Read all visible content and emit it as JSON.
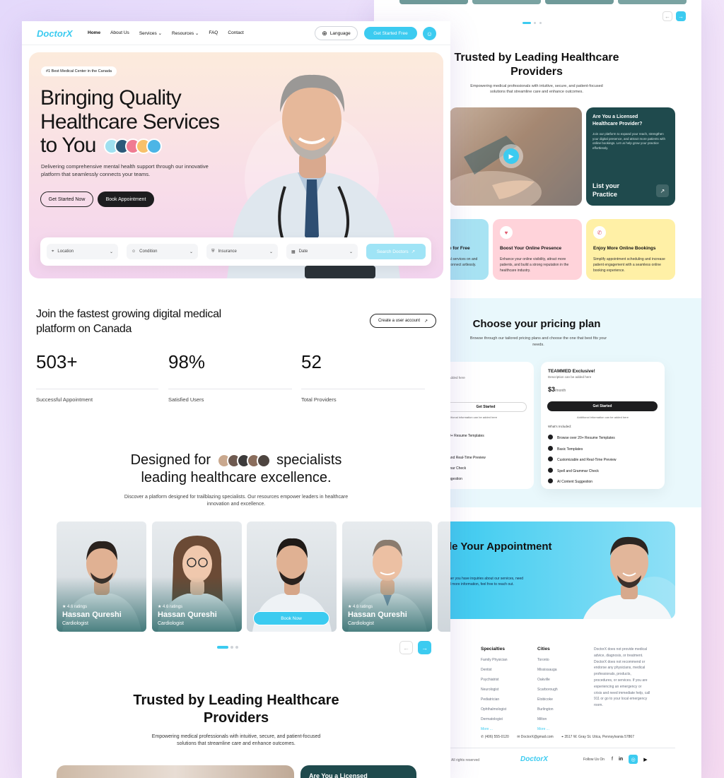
{
  "brand": {
    "logo": "DoctorX",
    "accent": "#3ccbf0",
    "dark": "#1d1d1f",
    "teal": "#1f4a4d"
  },
  "nav": {
    "items": [
      "Home",
      "About Us",
      "Services",
      "Resources",
      "FAQ",
      "Contact"
    ],
    "language": "Language",
    "cta": "Get Started Free"
  },
  "hero": {
    "badge": "#1 Best Medical Center in the Canada",
    "title_line1": "Bringing Quality",
    "title_line2": "Healthcare Services",
    "title_line3": "to You",
    "subtitle": "Delivering comprehensive mental health support through our innovative platform that seamlessly connects your teams.",
    "btn_start": "Get Started Now",
    "btn_book": "Book Appointment"
  },
  "search": {
    "location": "Location",
    "condition": "Condition",
    "insurance": "Insurance",
    "date": "Date",
    "button": "Search Doctors"
  },
  "stats": {
    "heading": "Join the fastest growing digital medical platform on Canada",
    "create_btn": "Create a user account",
    "items": [
      {
        "value": "503+",
        "label": "Successful Appointment"
      },
      {
        "value": "98%",
        "label": "Satisfied Users"
      },
      {
        "value": "52",
        "label": "Total Providers"
      }
    ]
  },
  "designed": {
    "title_pre": "Designed for",
    "title_post": "specialists",
    "title_line2": "leading healthcare excellence.",
    "subtitle": "Discover a platform designed for trailblazing specialists. Our resources empower leaders in healthcare innovation and excellence."
  },
  "doctors": [
    {
      "name": "Hassan Qureshi",
      "role": "Cardiologist",
      "rating": "4.6 ratings"
    },
    {
      "name": "Hassan Qureshi",
      "role": "Cardiologist",
      "rating": "4.6 ratings"
    },
    {
      "book": "Book Now"
    },
    {
      "name": "Hassan Qureshi",
      "role": "Cardiologist",
      "rating": "4.6 ratings"
    }
  ],
  "trusted": {
    "title_line1": "Trusted by Leading Healthcare",
    "title_line2": "Providers",
    "subtitle": "Empowering medical professionals with intuitive, secure, and patient-focused solutions that streamline care and enhance outcomes.",
    "card_title": "Are You a Licensed Healthcare Provider?",
    "card_text": "Join our platform to expand your reach, strengthen your digital presence, and attract more patients with online bookings. Let us help grow your practice effortlessly.",
    "card_cta": "List your Practice",
    "card_cut": "Are You a Licensed"
  },
  "features": [
    {
      "title": "e for Free",
      "text": "al services on and connect artlessly."
    },
    {
      "title": "Boost Your Online Presence",
      "text": "Enhance your online visibility, attract more patients, and build a strong reputation in the healthcare industry."
    },
    {
      "title": "Enjoy More Online Bookings",
      "text": "Simplify appointment scheduling and increase patient engagement with a seamless online booking experience."
    }
  ],
  "pricing": {
    "title": "Choose your pricing plan",
    "subtitle": "Browse through our tailored pricing plans and choose the one that best fits your needs.",
    "left_desc": "added here",
    "left_btn": "Get Started",
    "left_note": "ditional information can be added here",
    "left_items": [
      "0+ Resume Templates",
      "",
      "and Real-Time Preview",
      "mar Check",
      "ggestion"
    ],
    "plan": "TEAMMED Exclusive!",
    "plan_desc": "Description can be added here",
    "price": "$3",
    "per": "/month",
    "plan_btn": "Get Started",
    "plan_note": "Additional information can be added here",
    "included": "What's Included:",
    "items": [
      "Browse over 20+ Resume Templates",
      "Basic Templates",
      "Customizable and Real-Time Preview",
      "Spell and Grammar Check",
      "AI Content Suggestion"
    ]
  },
  "appointment": {
    "title": "le Your Appointment",
    "text_line1": "her you have inquiries about our services, need",
    "text_line2": "d more information, feel free to reach out."
  },
  "footer": {
    "specialties_title": "Specialties",
    "specialties": [
      "Family Physician",
      "Dentist",
      "Psychiatrist",
      "Neurologist",
      "Pediatrician",
      "Ophthalmologist",
      "Dermatologist",
      "More ..."
    ],
    "cities_title": "Cities",
    "cities": [
      "Toronto",
      "Mississauga",
      "Oakville",
      "Scarborough",
      "Etobicoke",
      "Burlington",
      "Milton",
      "More ..."
    ],
    "disclaimer": "DoctorX does not provide medical advice, diagnosis, or treatment. DoctorX does not recommend or endorse any physicians, medical professionals, products, procedures, or services. If you are experiencing an emergency or crisis and need immediate help, call 911 or go to your local emergency room.",
    "phone": "(406) 555-0120",
    "email": "DoctorX@gmail.com",
    "address": "3517 W. Gray St. Utica, Pennsylvania 57867",
    "rights": "All rights reserved",
    "follow": "Follow Us On"
  }
}
